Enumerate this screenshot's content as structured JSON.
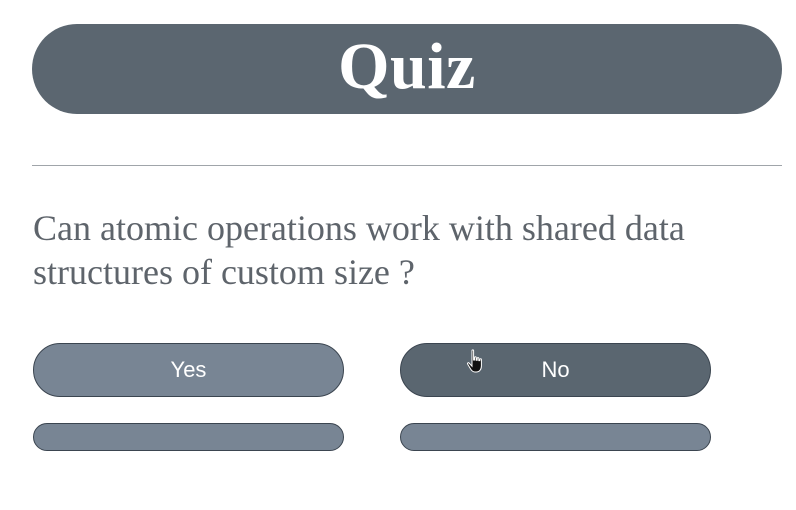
{
  "quiz": {
    "title": "Quiz",
    "question": "Can atomic operations work with shared data structures of custom size ?",
    "answers": [
      {
        "label": "Yes"
      },
      {
        "label": "No"
      }
    ]
  },
  "colors": {
    "banner": "#5b6670",
    "button_yes": "#788594",
    "button_no": "#5a6670",
    "question_text": "#5e646b"
  },
  "icons": {
    "cursor": "hand-pointer-icon"
  }
}
